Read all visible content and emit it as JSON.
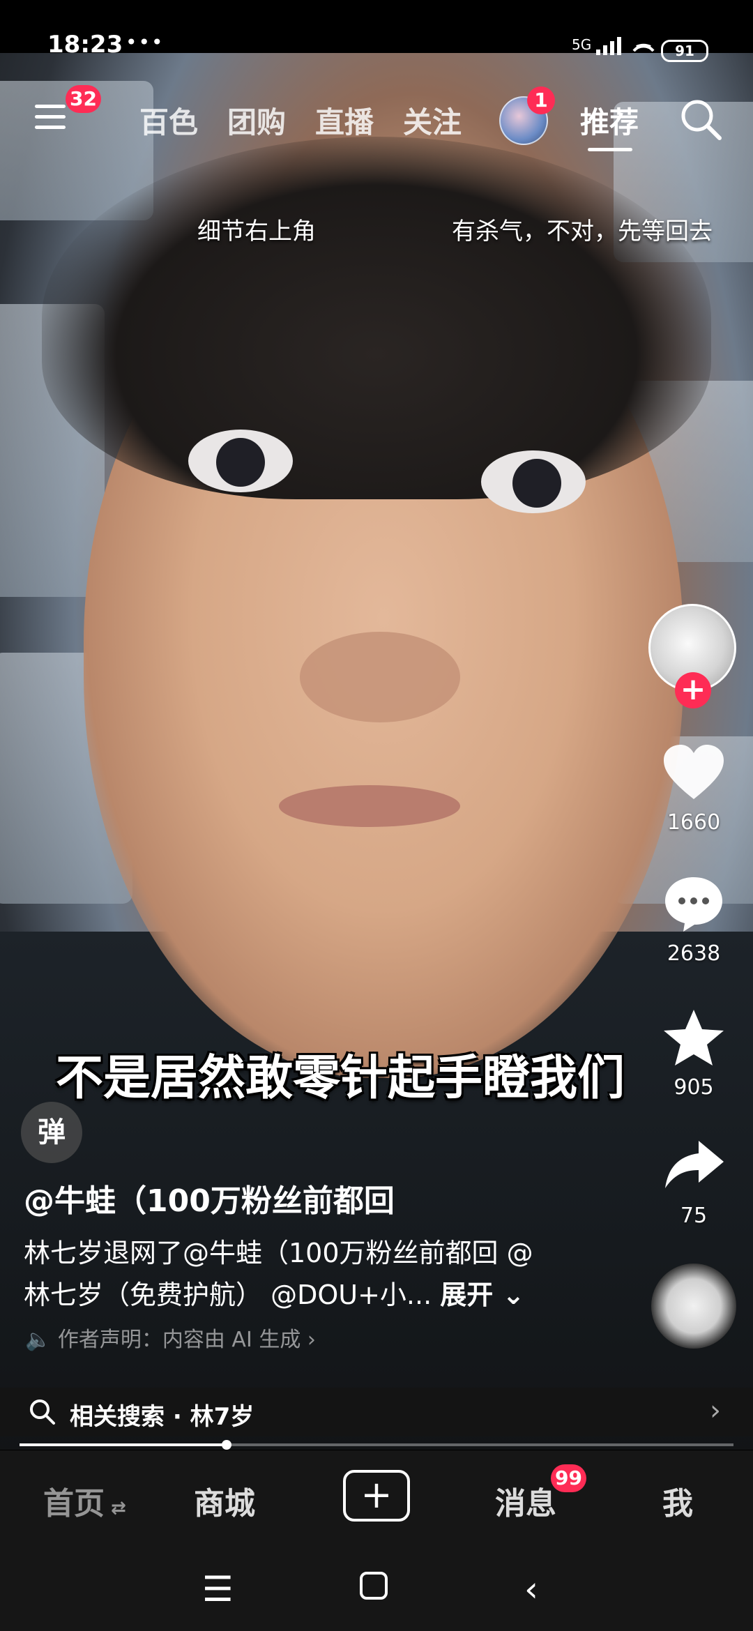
{
  "status_bar": {
    "time": "18:23",
    "extra": "•••",
    "network": "5G",
    "battery": "91"
  },
  "top_nav": {
    "menu_badge": "32",
    "tabs": [
      "百色",
      "团购",
      "直播",
      "关注"
    ],
    "avatar_badge": "1",
    "active_tab": "推荐"
  },
  "captions": {
    "left": "细节右上角",
    "right": "有杀气，不对，先等回去"
  },
  "subtitle": "不是居然敢零针起手瞪我们",
  "right_rail": {
    "likes": "1660",
    "comments": "2638",
    "favorites": "905",
    "shares": "75"
  },
  "post": {
    "danmu_label": "弹",
    "author": "@牛蛙（100万粉丝前都回",
    "desc_line1": "林七岁退网了@牛蛙（100万粉丝前都回 @",
    "desc_line2": "林七岁（免费护航） @DOU+小...",
    "expand_label": "展开",
    "ai_note": "作者声明：内容由 AI 生成 ›"
  },
  "related_search": {
    "label": "相关搜索 · 林7岁"
  },
  "progress": {
    "fraction": 0.29
  },
  "tab_bar": {
    "home": "首页",
    "mall": "商城",
    "messages": "消息",
    "messages_badge": "99",
    "me": "我"
  },
  "colors": {
    "accent": "#fe2c55",
    "bar_bg": "#161616"
  }
}
